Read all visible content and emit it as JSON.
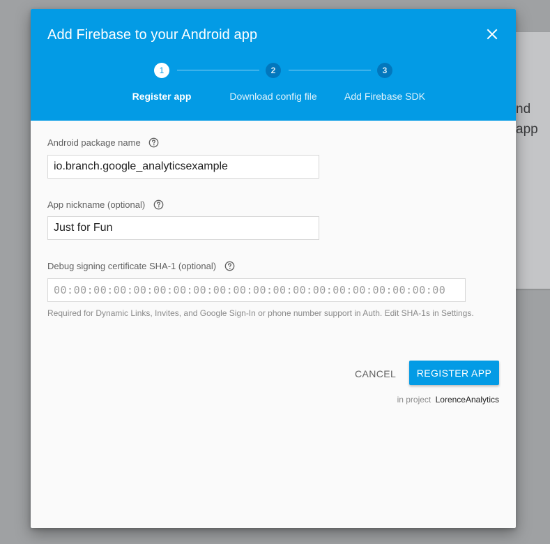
{
  "background": {
    "partial_text_line1": "nd",
    "partial_text_line2": "app"
  },
  "dialog": {
    "title": "Add Firebase to your Android app",
    "close_icon": "close-icon",
    "header_color": "#039be5",
    "steps": [
      {
        "number": "1",
        "label": "Register app",
        "active": true
      },
      {
        "number": "2",
        "label": "Download config file",
        "active": false
      },
      {
        "number": "3",
        "label": "Add Firebase SDK",
        "active": false
      }
    ],
    "fields": {
      "package_name": {
        "label": "Android package name",
        "value": "io.branch.google_analyticsexample"
      },
      "nickname": {
        "label": "App nickname (optional)",
        "value": "Just for Fun"
      },
      "sha1": {
        "label": "Debug signing certificate SHA-1 (optional)",
        "placeholder": "00:00:00:00:00:00:00:00:00:00:00:00:00:00:00:00:00:00:00:00",
        "hint": "Required for Dynamic Links, Invites, and Google Sign-In or phone number support in Auth. Edit SHA-1s in Settings."
      }
    },
    "actions": {
      "cancel_label": "CANCEL",
      "register_label": "REGISTER APP"
    },
    "project": {
      "prefix": "in project",
      "name": "LorenceAnalytics"
    }
  }
}
